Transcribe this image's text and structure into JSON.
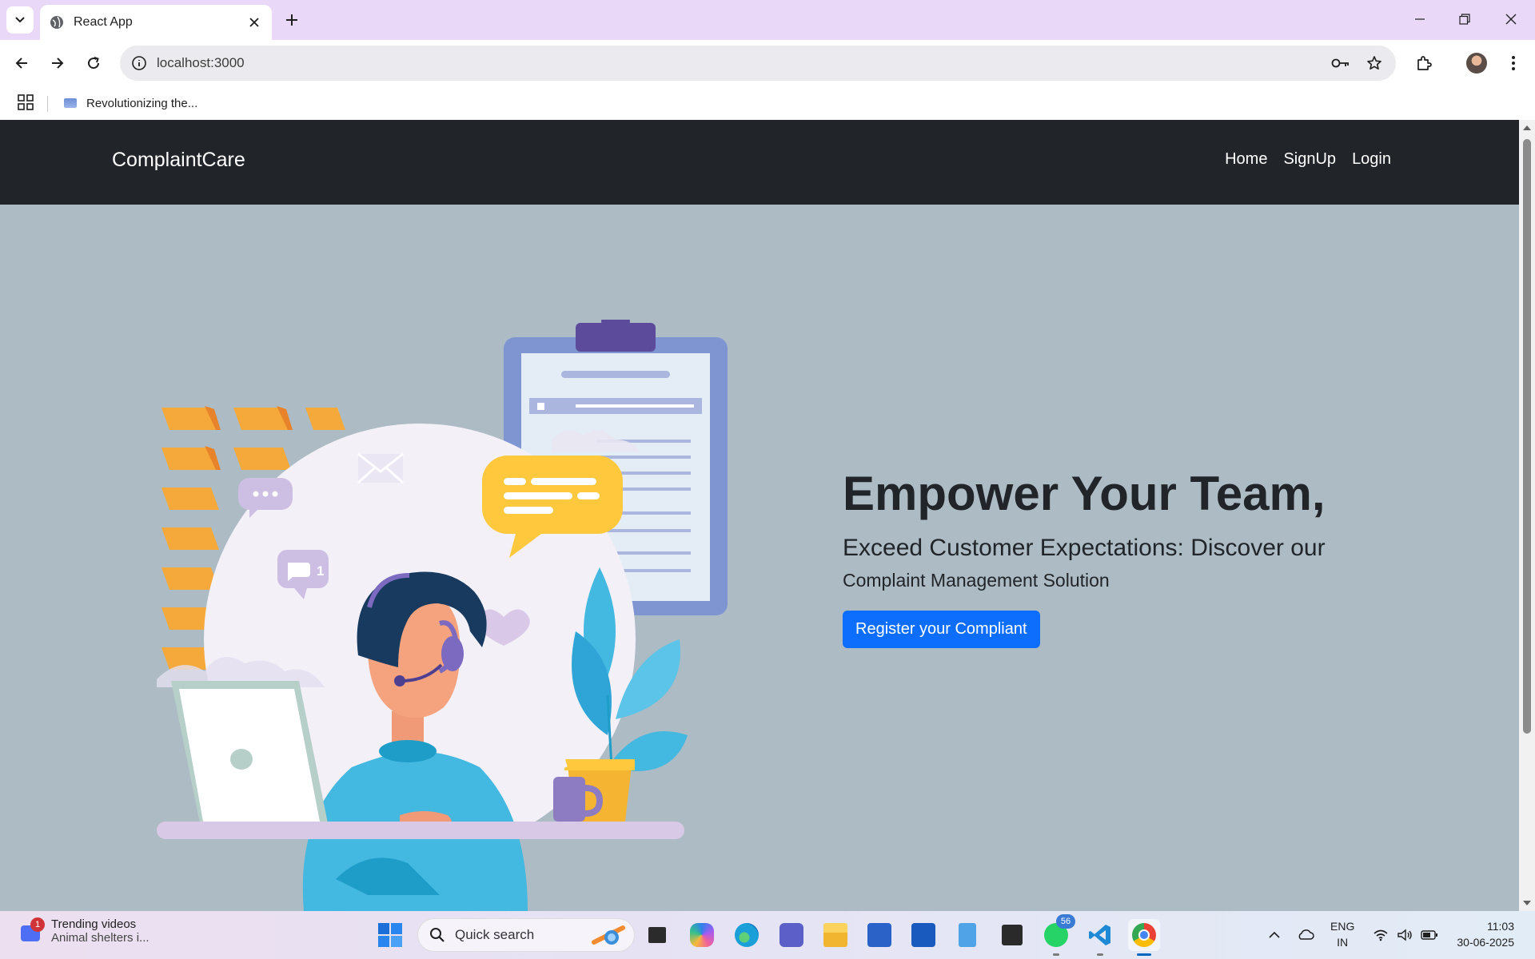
{
  "browser": {
    "tab_title": "React App",
    "url": "localhost:3000",
    "bookmark_label": "Revolutionizing the..."
  },
  "navbar": {
    "brand": "ComplaintCare",
    "links": [
      "Home",
      "SignUp",
      "Login"
    ]
  },
  "hero": {
    "title": "Empower Your Team,",
    "subtitle_line1": "Exceed Customer Expectations: Discover our",
    "subtitle_line2": "Complaint Management Solution",
    "cta_label": "Register your Compliant",
    "chat_badge": "1"
  },
  "taskbar": {
    "widget_badge": "1",
    "widget_title": "Trending videos",
    "widget_subtitle": "Animal shelters i...",
    "search_placeholder": "Quick search",
    "whatsapp_badge": "56",
    "lang_line1": "ENG",
    "lang_line2": "IN",
    "time": "11:03",
    "date": "30-06-2025"
  },
  "colors": {
    "navbar_bg": "#212529",
    "page_bg": "#adbcc4",
    "cta_bg": "#0d6efd",
    "tabstrip_bg": "#e9d8f7"
  },
  "icons": [
    "tab-search-icon",
    "globe-icon",
    "close-icon",
    "plus-icon",
    "minimize-icon",
    "restore-icon",
    "window-close-icon",
    "back-arrow-icon",
    "forward-arrow-icon",
    "reload-icon",
    "site-info-icon",
    "key-icon",
    "star-icon",
    "extensions-icon",
    "profile-avatar",
    "menu-dots-icon",
    "apps-grid-icon",
    "windows-start-icon",
    "search-icon"
  ]
}
